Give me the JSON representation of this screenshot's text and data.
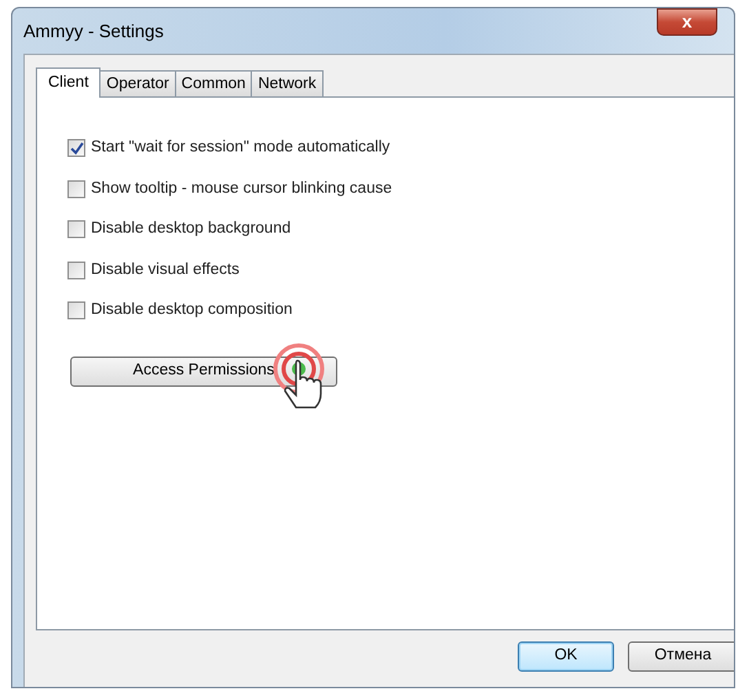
{
  "window": {
    "title": "Ammyy - Settings",
    "close": "x"
  },
  "tabs": [
    {
      "label": "Client",
      "selected": true
    },
    {
      "label": "Operator",
      "selected": false
    },
    {
      "label": "Common",
      "selected": false
    },
    {
      "label": "Network",
      "selected": false
    }
  ],
  "options": [
    {
      "label": "Start \"wait for session\" mode automatically",
      "checked": true
    },
    {
      "label": "Show tooltip - mouse cursor blinking cause",
      "checked": false
    },
    {
      "label": "Disable desktop background",
      "checked": false
    },
    {
      "label": "Disable visual effects",
      "checked": false
    },
    {
      "label": "Disable desktop composition",
      "checked": false
    }
  ],
  "access_button": "Access Permissions",
  "buttons": [
    {
      "label": "OK",
      "default": true
    },
    {
      "label": "Отмена",
      "default": false
    }
  ]
}
